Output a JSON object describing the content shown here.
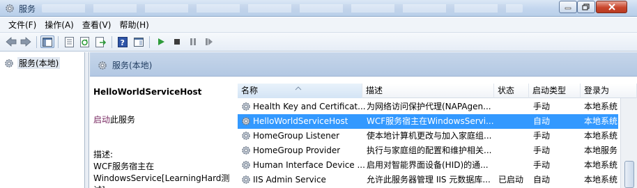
{
  "window": {
    "title": "服务"
  },
  "menu": [
    {
      "label": "文件(F)"
    },
    {
      "label": "操作(A)"
    },
    {
      "label": "查看(V)"
    },
    {
      "label": "帮助(H)"
    }
  ],
  "tree": {
    "root_label": "服务(本地)"
  },
  "pane": {
    "header": "服务(本地)"
  },
  "detail": {
    "service_name": "HelloWorldServiceHost",
    "start_link": "启动",
    "start_suffix": "此服务",
    "desc_label": "描述:",
    "desc_text": "WCF服务宿主在WindowsService[LearningHard测试]"
  },
  "columns": [
    {
      "label": "名称"
    },
    {
      "label": "描述"
    },
    {
      "label": "状态"
    },
    {
      "label": "启动类型"
    },
    {
      "label": "登录为"
    }
  ],
  "services": [
    {
      "name": "Health Key and Certificat...",
      "desc": "为网络访问保护代理(NAPAgen...",
      "status": "",
      "startup": "手动",
      "logon": "本地系统"
    },
    {
      "name": "HelloWorldServiceHost",
      "desc": "WCF服务宿主在WindowsServi...",
      "status": "",
      "startup": "自动",
      "logon": "本地系统"
    },
    {
      "name": "HomeGroup Listener",
      "desc": "使本地计算机更改与加入家庭组...",
      "status": "",
      "startup": "手动",
      "logon": "本地系统"
    },
    {
      "name": "HomeGroup Provider",
      "desc": "执行与家庭组的配置和维护相关...",
      "status": "",
      "startup": "手动",
      "logon": "本地服务"
    },
    {
      "name": "Human Interface Device ...",
      "desc": "启用对智能界面设备(HID)的通...",
      "status": "",
      "startup": "手动",
      "logon": "本地系统"
    },
    {
      "name": "IIS Admin Service",
      "desc": "允许此服务器管理 IIS 元数据库...",
      "status": "已启动",
      "startup": "自动",
      "logon": "本地系统"
    }
  ],
  "selected_row": 1,
  "colors": {
    "selection": "#3399ff",
    "link": "#7a2b63"
  }
}
